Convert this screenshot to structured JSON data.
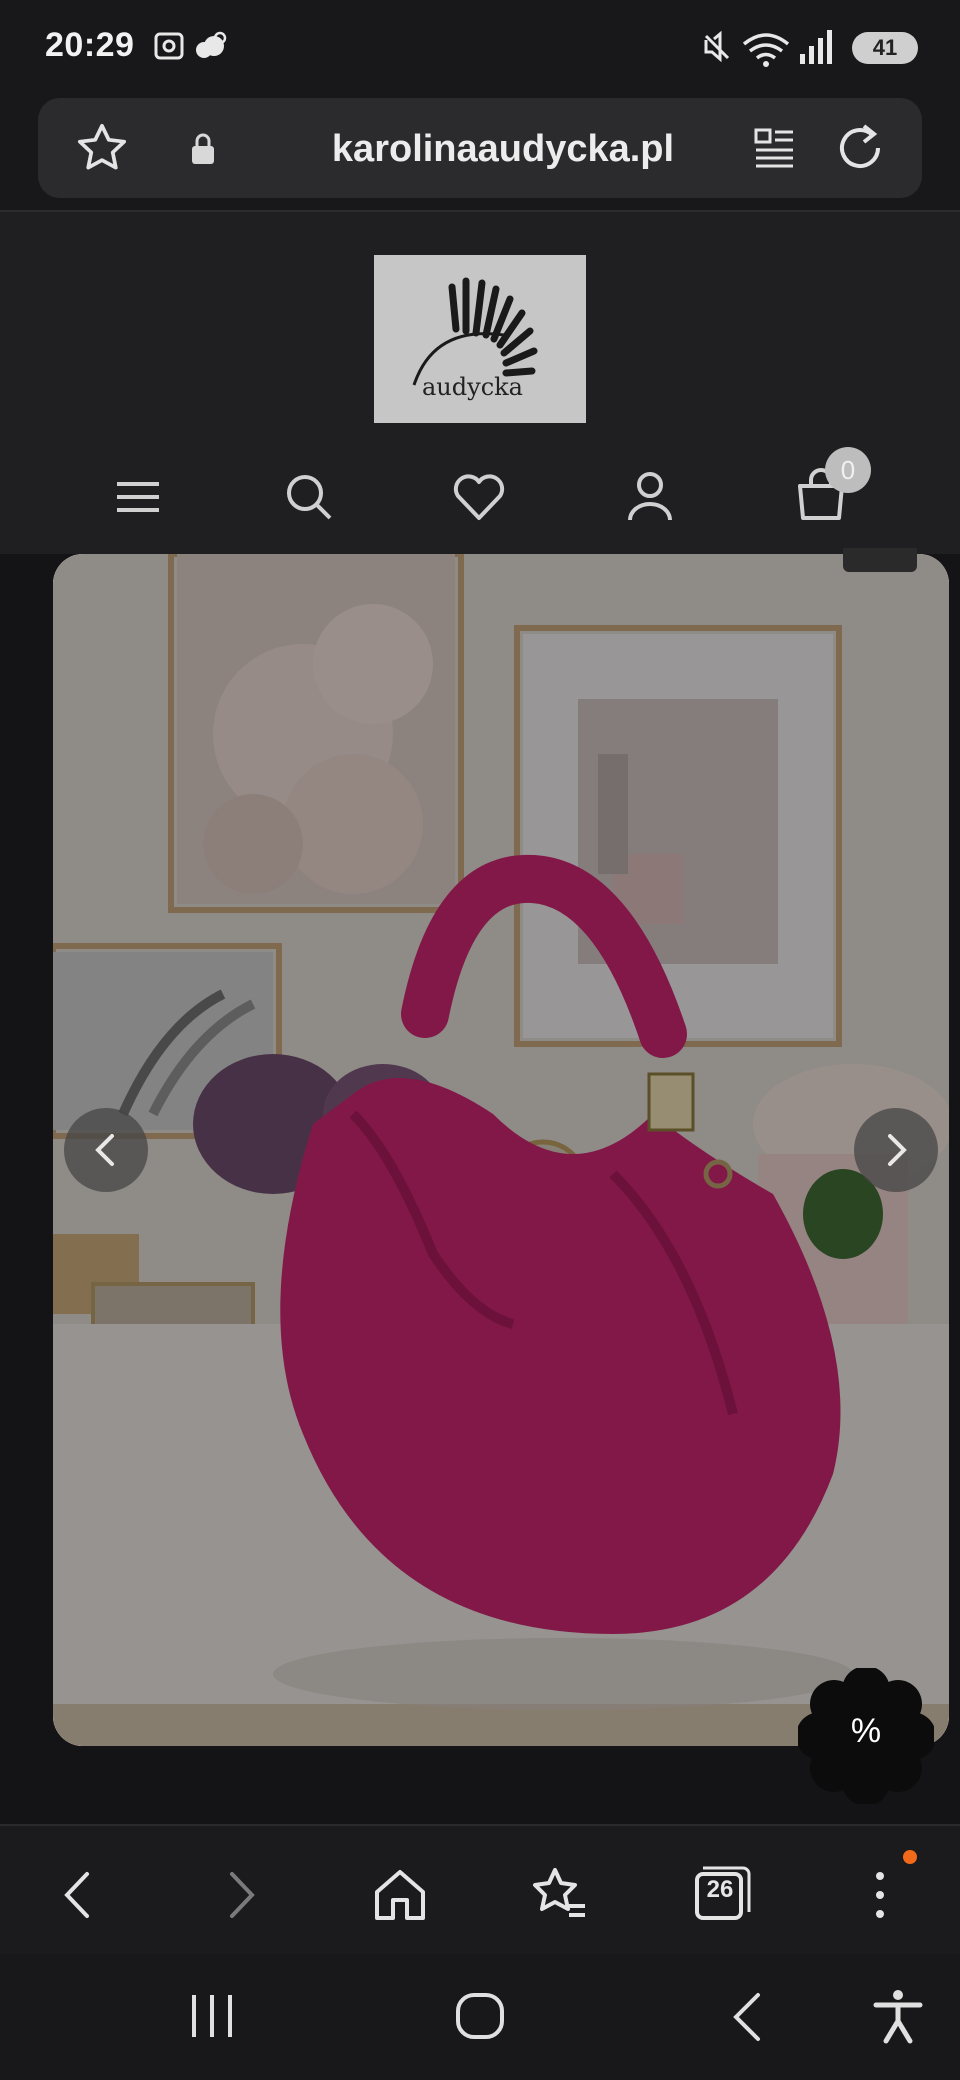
{
  "status_bar": {
    "time": "20:29",
    "battery": "41",
    "icons": [
      "screenshot-icon",
      "weather-icon",
      "mute-icon",
      "wifi-icon",
      "signal-icon"
    ]
  },
  "browser": {
    "url": "karolinaaudycka.pl"
  },
  "site": {
    "logo_text": "audycka",
    "cart_count": "0"
  },
  "product_gallery": {
    "image_alt": "Pink suede hobo shoulder bag on a white shelf"
  },
  "promo": {
    "label": "%"
  },
  "toolbar": {
    "tabs_count": "26"
  },
  "colors": {
    "accent_dot": "#f06a1a",
    "bag": "#c8266e"
  }
}
